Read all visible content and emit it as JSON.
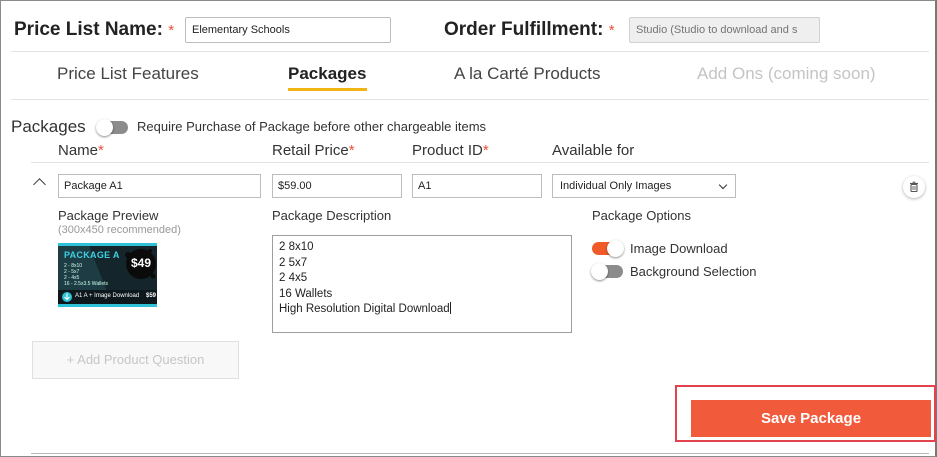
{
  "header": {
    "price_list_label": "Price List Name:",
    "price_list_value": "Elementary Schools",
    "fulfillment_label": "Order Fulfillment:",
    "fulfillment_placeholder": "Studio (Studio to download and s",
    "required_mark": "*"
  },
  "tabs": [
    {
      "label": "Price List Features"
    },
    {
      "label": "Packages"
    },
    {
      "label": "A la Carté Products"
    },
    {
      "label": "Add Ons (coming soon)"
    }
  ],
  "packages": {
    "title": "Packages",
    "require_toggle_label": "Require Purchase of Package before other chargeable items"
  },
  "columns": {
    "name": "Name",
    "retail_price": "Retail Price",
    "product_id": "Product ID",
    "available_for": "Available for"
  },
  "package_row": {
    "name": "Package A1",
    "price": "$59.00",
    "product_id": "A1",
    "available_for": "Individual Only Images"
  },
  "preview": {
    "label": "Package Preview",
    "hint": "(300x450 recommended)",
    "thumb": {
      "title": "PACKAGE A",
      "price": "$49",
      "lines": [
        "2 - 8x10",
        "2 - 5x7",
        "2 - 4x5",
        "16 - 2.5x3.5 Wallets"
      ],
      "footer": "A1 A + Image Download",
      "footer_price": "$59"
    }
  },
  "description": {
    "label": "Package Description",
    "lines": [
      "2 8x10",
      "2 5x7",
      "2 4x5",
      "16 Wallets",
      "High Resolution Digital Download"
    ]
  },
  "options": {
    "label": "Package Options",
    "image_download": "Image Download",
    "background_selection": "Background Selection"
  },
  "add_question_label": "+ Add Product Question",
  "save_label": "Save Package",
  "colors": {
    "accent": "#f15a3a",
    "tab_underline": "#f2b315",
    "highlight": "#e2434e"
  }
}
